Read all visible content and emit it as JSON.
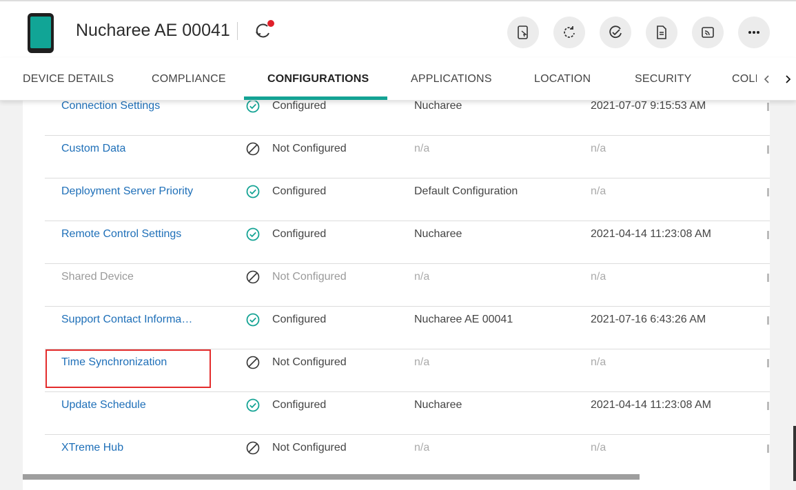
{
  "header": {
    "device_name": "Nucharee AE 00041",
    "actions": [
      {
        "icon": "remote-control-icon"
      },
      {
        "icon": "refresh-icon"
      },
      {
        "icon": "check-circle-icon"
      },
      {
        "icon": "document-icon"
      },
      {
        "icon": "cast-icon"
      },
      {
        "icon": "more-icon"
      }
    ]
  },
  "tabs": [
    {
      "label": "DEVICE DETAILS"
    },
    {
      "label": "COMPLIANCE"
    },
    {
      "label": "CONFIGURATIONS",
      "active": true
    },
    {
      "label": "APPLICATIONS"
    },
    {
      "label": "LOCATION"
    },
    {
      "label": "SECURITY"
    },
    {
      "label": "COLI"
    }
  ],
  "rows": [
    {
      "name": "Connection Settings",
      "status": "Configured",
      "source": "Nucharee",
      "date": "2021-07-07 9:15:53 AM"
    },
    {
      "name": "Custom Data",
      "status": "Not Configured",
      "source": "n/a",
      "date": "n/a"
    },
    {
      "name": "Deployment Server Priority",
      "status": "Configured",
      "source": "Default Configuration",
      "date": "n/a"
    },
    {
      "name": "Remote Control Settings",
      "status": "Configured",
      "source": "Nucharee",
      "date": "2021-04-14 11:23:08 AM"
    },
    {
      "name": "Shared Device",
      "status": "Not Configured",
      "source": "n/a",
      "date": "n/a",
      "disabled": true
    },
    {
      "name": "Support Contact Informa…",
      "status": "Configured",
      "source": "Nucharee AE 00041",
      "date": "2021-07-16 6:43:26 AM"
    },
    {
      "name": "Time Synchronization",
      "status": "Not Configured",
      "source": "n/a",
      "date": "n/a",
      "highlighted": true
    },
    {
      "name": "Update Schedule",
      "status": "Configured",
      "source": "Nucharee",
      "date": "2021-04-14 11:23:08 AM"
    },
    {
      "name": "XTreme Hub",
      "status": "Not Configured",
      "source": "n/a",
      "date": "n/a"
    }
  ],
  "colors": {
    "accent": "#14a394",
    "link": "#1e6fb8",
    "highlight": "#e32b2b",
    "notification": "#e0202a"
  }
}
